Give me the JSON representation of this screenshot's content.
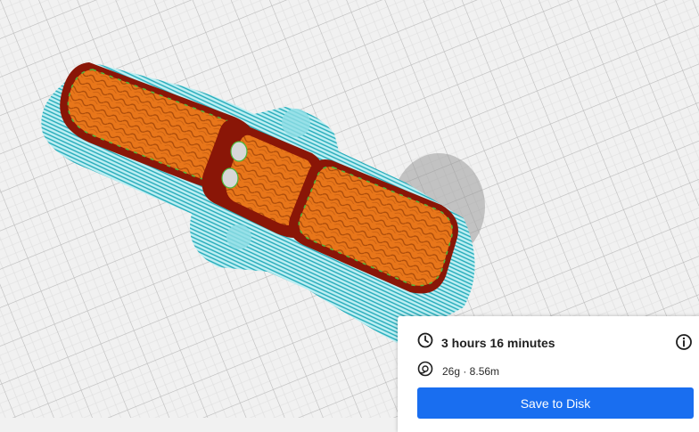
{
  "print_estimate": {
    "time": "3 hours 16 minutes",
    "material": "26g · 8.56m",
    "time_icon": "clock-icon",
    "material_icon": "filament-spool-icon",
    "info_icon": "info-icon"
  },
  "actions": {
    "save_label": "Save to Disk"
  },
  "colors": {
    "build_plate": "#f1f1f1",
    "grid": "#c8c8c8",
    "skirt": "#2fb7c4",
    "wall": "#8a1607",
    "infill": "#e8761a",
    "top_skin": "#4fb83a",
    "accent": "#196ef0"
  }
}
